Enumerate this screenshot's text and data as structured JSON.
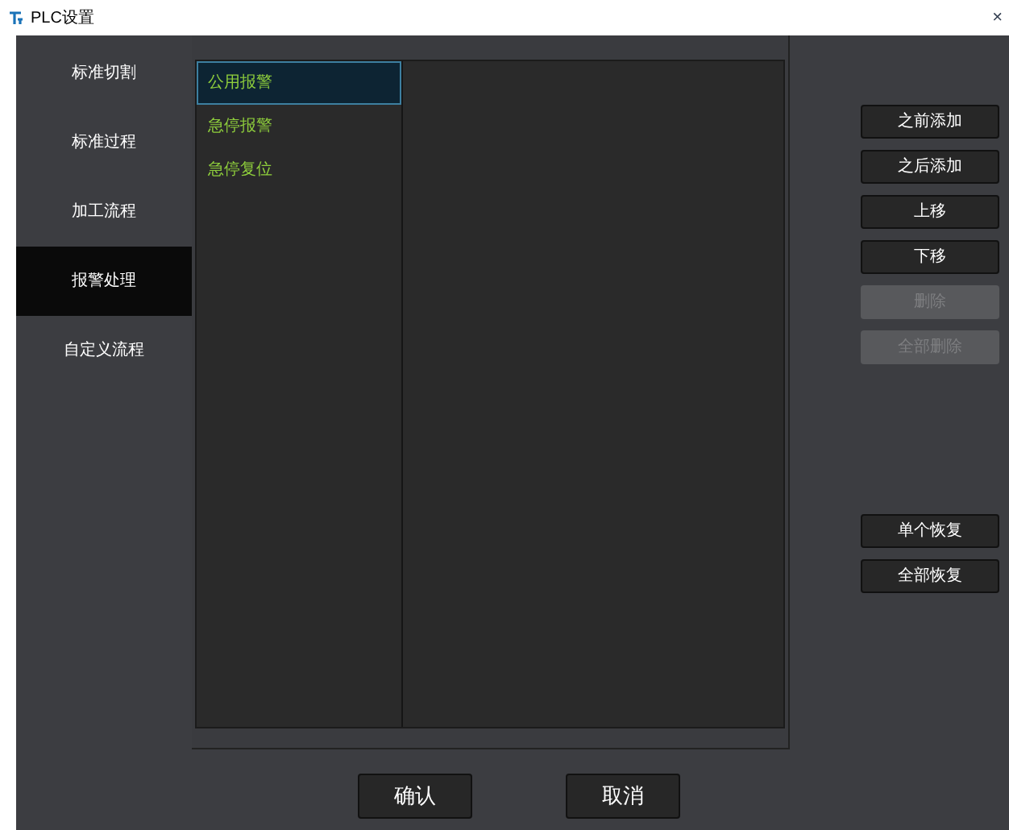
{
  "window": {
    "title": "PLC设置",
    "close": "×"
  },
  "nav": [
    {
      "label": "标准切割",
      "selected": false
    },
    {
      "label": "标准过程",
      "selected": false
    },
    {
      "label": "加工流程",
      "selected": false
    },
    {
      "label": "报警处理",
      "selected": true
    },
    {
      "label": "自定义流程",
      "selected": false
    }
  ],
  "list": [
    {
      "label": "公用报警",
      "selected": true
    },
    {
      "label": "急停报警",
      "selected": false
    },
    {
      "label": "急停复位",
      "selected": false
    }
  ],
  "actions": [
    {
      "label": "之前添加",
      "disabled": false
    },
    {
      "label": "之后添加",
      "disabled": false
    },
    {
      "label": "上移",
      "disabled": false
    },
    {
      "label": "下移",
      "disabled": false
    },
    {
      "label": "删除",
      "disabled": true
    },
    {
      "label": "全部删除",
      "disabled": true
    }
  ],
  "restore": [
    {
      "label": "单个恢复",
      "disabled": false
    },
    {
      "label": "全部恢复",
      "disabled": false
    }
  ],
  "footer": [
    "确认",
    "取消"
  ]
}
